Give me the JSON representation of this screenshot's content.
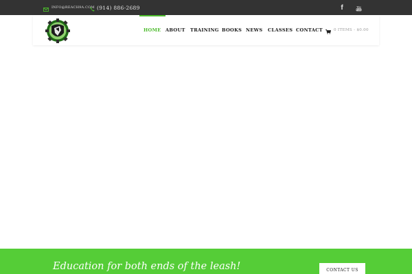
{
  "topbar": {
    "email": "info@reach9a.com",
    "phone": "(914) 886-2689",
    "icons": {
      "email": "envelope-icon",
      "phone": "phone-icon",
      "facebook": "facebook-icon",
      "youtube": "youtube-icon"
    },
    "social": {
      "facebook_glyph": "f",
      "youtube_glyph": "You\nTube"
    }
  },
  "nav": {
    "items": [
      "HOME",
      "ABOUT",
      "TRAINING",
      "BOOKS",
      "NEWS",
      "CLASSES",
      "CONTACT"
    ],
    "active": "HOME"
  },
  "cart": {
    "label": "0 ITEMS - $0.00",
    "icon": "cart-icon"
  },
  "band": {
    "tagline": "Education for both ends of the leash!",
    "cta": "CONTACT US"
  },
  "colors": {
    "accent": "#4cbb2c",
    "band": "#55cd37",
    "topbar": "#333333"
  }
}
